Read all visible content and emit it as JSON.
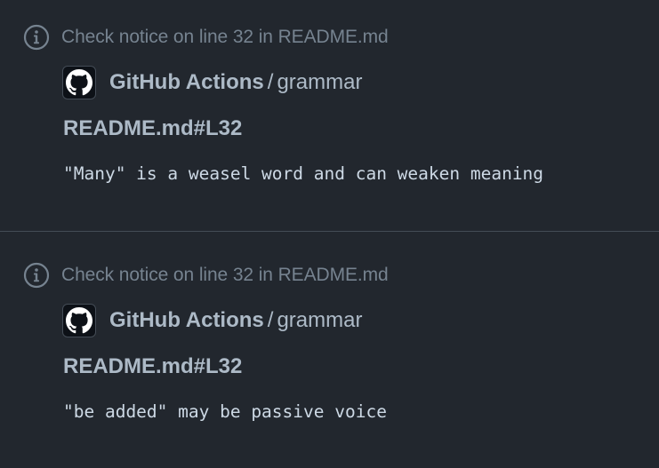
{
  "notices": [
    {
      "title": "Check notice on line 32 in README.md",
      "actor": "GitHub Actions",
      "separator": "/",
      "workflow": "grammar",
      "file_link": "README.md#L32",
      "message": "\"Many\" is a weasel word and can weaken meaning"
    },
    {
      "title": "Check notice on line 32 in README.md",
      "actor": "GitHub Actions",
      "separator": "/",
      "workflow": "grammar",
      "file_link": "README.md#L32",
      "message": "\"be added\" may be passive voice"
    }
  ],
  "colors": {
    "background": "#22272e",
    "divider": "#444c56",
    "muted_text": "#768390",
    "text": "#adbac7"
  },
  "icons": {
    "notice": "info-circle-icon",
    "avatar": "github-mark-icon"
  }
}
